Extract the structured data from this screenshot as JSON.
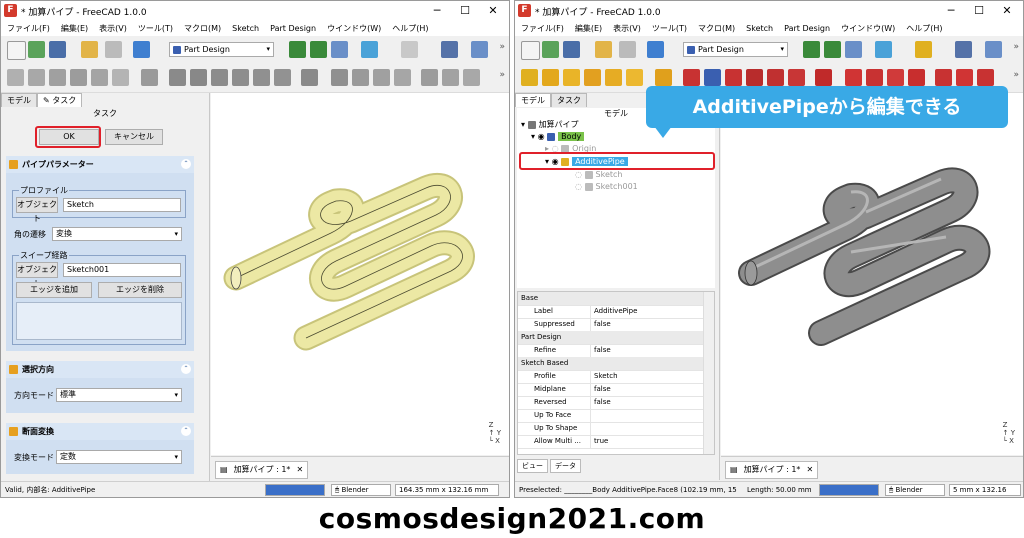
{
  "colors": {
    "accent": "#39a9e6",
    "highlight_red": "#e0202a",
    "pipe_yellow": "#e8e49c",
    "pipe_gray": "#8c8c8c",
    "section_blue": "#d0dff1"
  },
  "left": {
    "title": "* 加算パイプ - FreeCAD 1.0.0",
    "menu": [
      "ファイル(F)",
      "編集(E)",
      "表示(V)",
      "ツール(T)",
      "マクロ(M)",
      "Sketch",
      "Part Design",
      "ウインドウ(W)",
      "ヘルプ(H)"
    ],
    "workbench": "Part Design",
    "tabs": {
      "model": "モデル",
      "task": "タスク"
    },
    "panel_label": "タスク",
    "ok": "OK",
    "cancel": "キャンセル",
    "pipe_params": {
      "header": "パイプパラメーター",
      "profile_group": "プロファイル",
      "profile_btn": "オブジェクト",
      "profile_value": "Sketch",
      "corner_label": "角の遷移",
      "corner_value": "変換",
      "sweep_group": "スイープ経路",
      "sweep_btn": "オブジェクト",
      "sweep_value": "Sketch001",
      "add_edge": "エッジを追加",
      "remove_edge": "エッジを削除"
    },
    "orientation": {
      "header": "選択方向",
      "mode_label": "方向モード",
      "mode_value": "標準"
    },
    "section": {
      "header": "断面変換",
      "mode_label": "変換モード",
      "mode_value": "定数"
    },
    "doc_tab": "加算パイプ : 1*",
    "status": "Valid, 内部名: AdditivePipe",
    "nav": "Blender",
    "dims": "164.35 mm x 132.16 mm"
  },
  "right": {
    "title": "* 加算パイプ - FreeCAD 1.0.0",
    "menu": [
      "ファイル(F)",
      "編集(E)",
      "表示(V)",
      "ツール(T)",
      "マクロ(M)",
      "Sketch",
      "Part Design",
      "ウインドウ(W)",
      "ヘルプ(H)"
    ],
    "workbench": "Part Design",
    "tabs": {
      "model": "モデル",
      "task": "タスク"
    },
    "panel_label": "モデル",
    "tree": {
      "doc": "加算パイプ",
      "body": "Body",
      "origin": "Origin",
      "pipe": "AdditivePipe",
      "sketch": "Sketch",
      "sketch001": "Sketch001"
    },
    "props": [
      {
        "group": "Base"
      },
      {
        "k": "Label",
        "v": "AdditivePipe"
      },
      {
        "k": "Suppressed",
        "v": "false"
      },
      {
        "group": "Part Design"
      },
      {
        "k": "Refine",
        "v": "false"
      },
      {
        "group": "Sketch Based"
      },
      {
        "k": "Profile",
        "v": "Sketch"
      },
      {
        "k": "Midplane",
        "v": "false"
      },
      {
        "k": "Reversed",
        "v": "false"
      },
      {
        "k": "Up To Face",
        "v": ""
      },
      {
        "k": "Up To Shape",
        "v": ""
      },
      {
        "k": "Allow Multi ...",
        "v": "true"
      }
    ],
    "bottom_tabs": [
      "ビュー",
      "データ"
    ],
    "doc_tab": "加算パイプ : 1*",
    "status": "Preselected: ________Body AdditivePipe.Face8 (102.19 mm, 15",
    "length": "Length: 50.00 mm",
    "nav": "Blender",
    "dims": "5 mm x 132.16"
  },
  "callout": "AdditivePipeから編集できる",
  "caption": "cosmosdesign2021.com"
}
